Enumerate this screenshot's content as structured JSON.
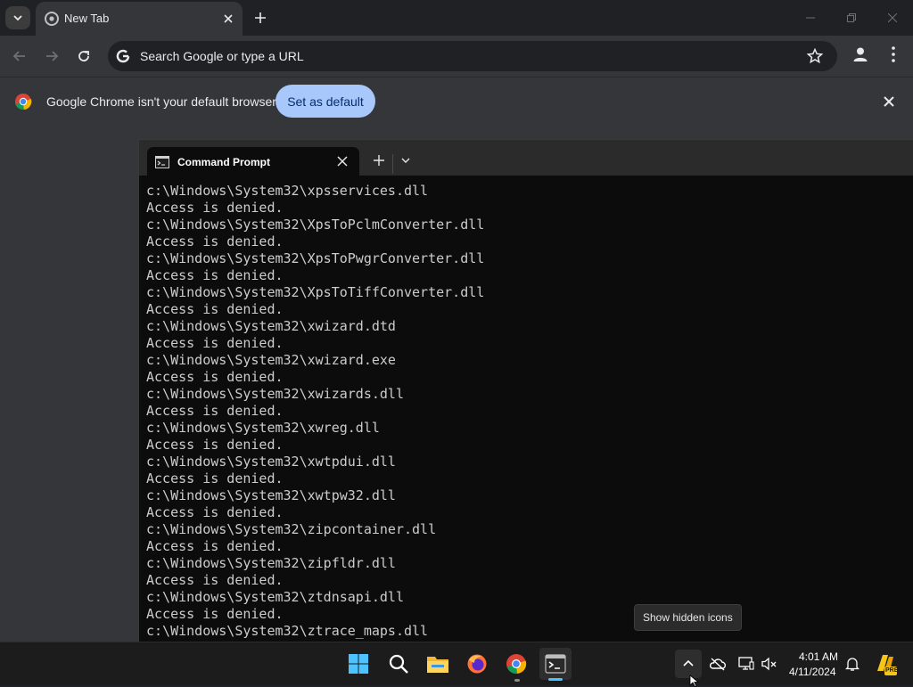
{
  "browser": {
    "tab_title": "New Tab",
    "omnibox_placeholder": "Search Google or type a URL",
    "infobar_message": "Google Chrome isn't your default browser",
    "set_default_label": "Set as default"
  },
  "terminal": {
    "tab_title": "Command Prompt",
    "lines": [
      "c:\\Windows\\System32\\xpsservices.dll",
      "Access is denied.",
      "c:\\Windows\\System32\\XpsToPclmConverter.dll",
      "Access is denied.",
      "c:\\Windows\\System32\\XpsToPwgrConverter.dll",
      "Access is denied.",
      "c:\\Windows\\System32\\XpsToTiffConverter.dll",
      "Access is denied.",
      "c:\\Windows\\System32\\xwizard.dtd",
      "Access is denied.",
      "c:\\Windows\\System32\\xwizard.exe",
      "Access is denied.",
      "c:\\Windows\\System32\\xwizards.dll",
      "Access is denied.",
      "c:\\Windows\\System32\\xwreg.dll",
      "Access is denied.",
      "c:\\Windows\\System32\\xwtpdui.dll",
      "Access is denied.",
      "c:\\Windows\\System32\\xwtpw32.dll",
      "Access is denied.",
      "c:\\Windows\\System32\\zipcontainer.dll",
      "Access is denied.",
      "c:\\Windows\\System32\\zipfldr.dll",
      "Access is denied.",
      "c:\\Windows\\System32\\ztdnsapi.dll",
      "Access is denied.",
      "c:\\Windows\\System32\\ztrace_maps.dll"
    ]
  },
  "tooltip": "Show hidden icons",
  "taskbar": {
    "apps": [
      "start-icon",
      "search-icon",
      "file-explorer-icon",
      "firefox-icon",
      "chrome-icon",
      "terminal-icon"
    ],
    "tray_icons": [
      "chevron-up-icon",
      "onedrive-icon",
      "display-icon",
      "volume-icon",
      "bell-icon",
      "copilot-icon"
    ],
    "time": "4:01 AM",
    "date": "4/11/2024",
    "copilot_badge": "PRE"
  },
  "colors": {
    "accent": "#4cc2ff",
    "button_blue": "#a8c7fa"
  }
}
